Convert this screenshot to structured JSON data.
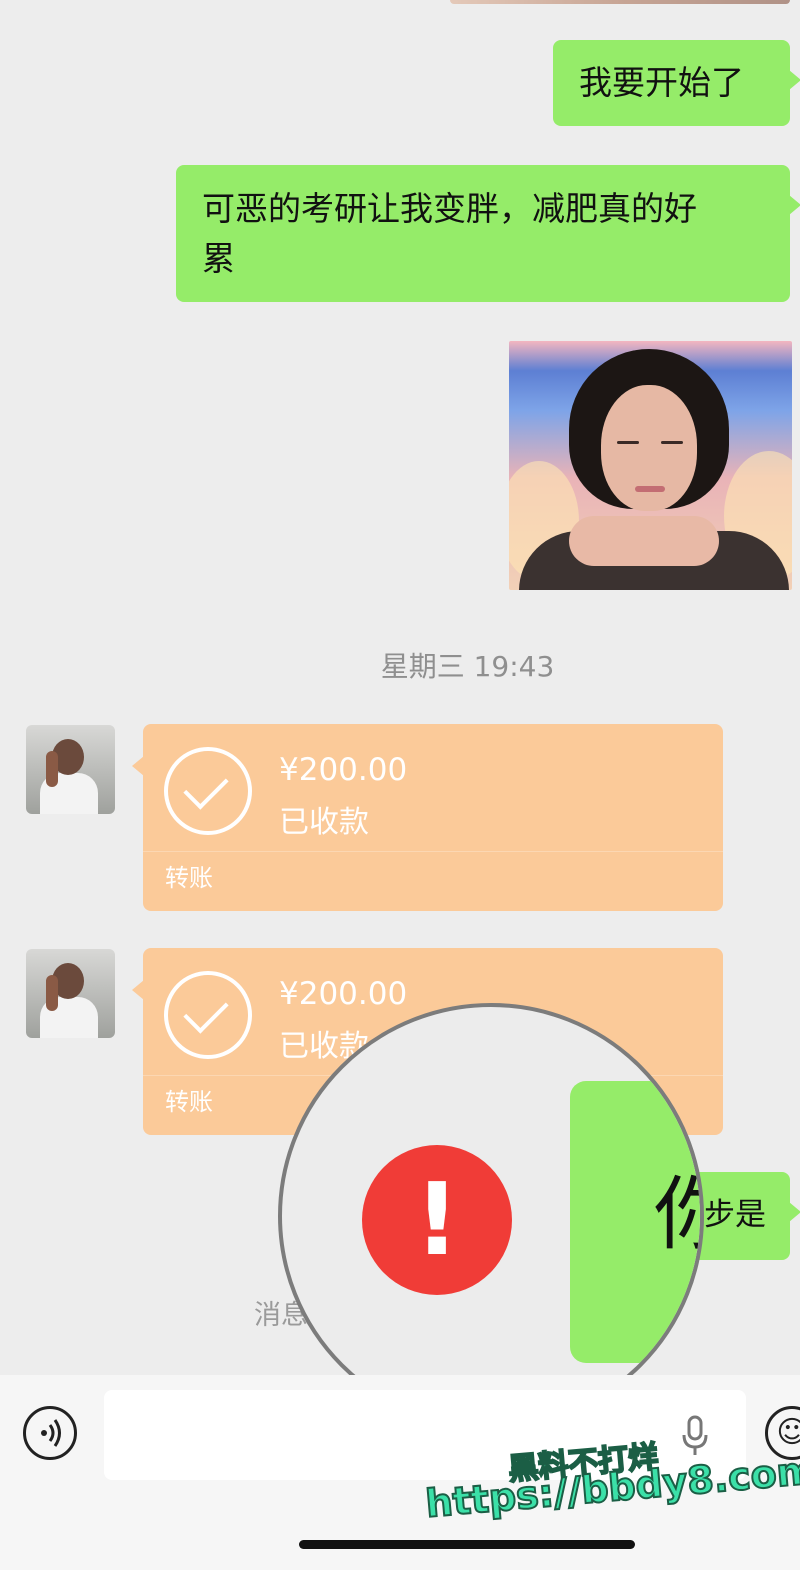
{
  "messages": {
    "out_1": "我要开始了",
    "out_2_line1": "可恶的考研让我变胖，减肥真的好",
    "out_2_line2": "累",
    "out_3_partial": "步是",
    "recall_notice_partial": "消息"
  },
  "timestamp": "星期三 19:43",
  "transfers": [
    {
      "amount": "¥200.00",
      "status": "已收款",
      "label": "转账"
    },
    {
      "amount": "¥200.00",
      "status": "已收款",
      "label": "转账"
    }
  ],
  "magnifier": {
    "error_symbol": "!",
    "glyph": "你"
  },
  "input": {
    "value": "",
    "voice_icon": "voice-icon",
    "emoji_icon": "emoji-icon",
    "mic_icon": "microphone-icon"
  },
  "watermark": {
    "line1": "黑料不打烊",
    "line2": "https://bbdy8.com"
  },
  "colors": {
    "bubble_out": "#95ec69",
    "transfer_card": "#fbca99",
    "error_red": "#f03c37",
    "background": "#ededed"
  }
}
